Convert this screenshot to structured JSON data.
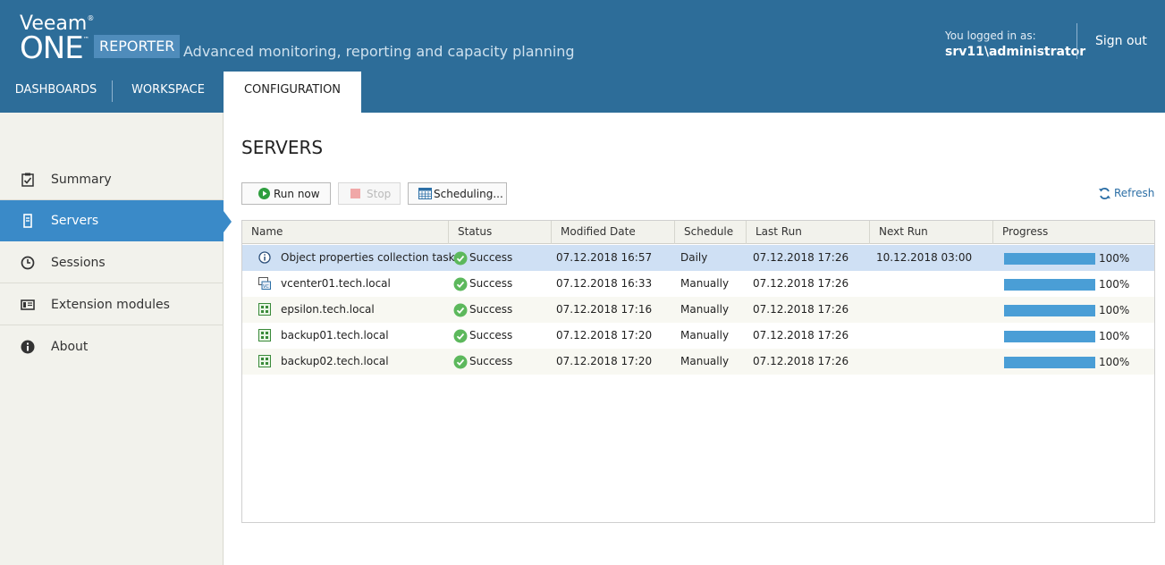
{
  "header": {
    "brand": "Veeam",
    "brand_mark": "®",
    "product": "ONE",
    "product_mark": "™",
    "badge": "REPORTER",
    "tagline": "Advanced monitoring, reporting and capacity planning",
    "logged_in_label": "You logged in as:",
    "user": "srv11\\administrator",
    "sign_out": "Sign out",
    "background_color": "#2d6d99"
  },
  "nav": {
    "tabs": [
      {
        "label": "DASHBOARDS"
      },
      {
        "label": "WORKSPACE"
      },
      {
        "label": "CONFIGURATION",
        "active": true
      }
    ]
  },
  "sidebar": {
    "items": [
      {
        "label": "Summary",
        "icon": "clipboard-check-icon"
      },
      {
        "label": "Servers",
        "icon": "server-icon",
        "active": true
      },
      {
        "label": "Sessions",
        "icon": "clock-icon"
      },
      {
        "label": "Extension modules",
        "icon": "module-icon"
      },
      {
        "label": "About",
        "icon": "info-icon"
      }
    ],
    "accent_color": "#3a8ac8"
  },
  "main": {
    "title": "SERVERS",
    "toolbar": {
      "run_now": "Run now",
      "stop": "Stop",
      "scheduling": "Scheduling...",
      "refresh": "Refresh"
    },
    "table": {
      "columns": [
        "Name",
        "Status",
        "Modified Date",
        "Schedule",
        "Last Run",
        "Next Run",
        "Progress"
      ],
      "rows": [
        {
          "icon": "info-icon",
          "name": "Object properties collection task",
          "status": "Success",
          "modified": "07.12.2018 16:57",
          "schedule": "Daily",
          "last_run": "07.12.2018 17:26",
          "next_run": "10.12.2018 03:00",
          "progress": 100,
          "progress_label": "100%",
          "selected": true
        },
        {
          "icon": "vcenter-icon",
          "name": "vcenter01.tech.local",
          "status": "Success",
          "modified": "07.12.2018 16:33",
          "schedule": "Manually",
          "last_run": "07.12.2018 17:26",
          "next_run": "",
          "progress": 100,
          "progress_label": "100%"
        },
        {
          "icon": "backup-server-icon",
          "name": "epsilon.tech.local",
          "status": "Success",
          "modified": "07.12.2018 17:16",
          "schedule": "Manually",
          "last_run": "07.12.2018 17:26",
          "next_run": "",
          "progress": 100,
          "progress_label": "100%"
        },
        {
          "icon": "backup-server-icon",
          "name": "backup01.tech.local",
          "status": "Success",
          "modified": "07.12.2018 17:20",
          "schedule": "Manually",
          "last_run": "07.12.2018 17:26",
          "next_run": "",
          "progress": 100,
          "progress_label": "100%"
        },
        {
          "icon": "backup-server-icon",
          "name": "backup02.tech.local",
          "status": "Success",
          "modified": "07.12.2018 17:20",
          "schedule": "Manually",
          "last_run": "07.12.2018 17:26",
          "next_run": "",
          "progress": 100,
          "progress_label": "100%"
        }
      ],
      "status_color": "#5cb85c",
      "progress_color": "#4a9ed6",
      "selected_row_color": "#cfe0f4"
    }
  }
}
